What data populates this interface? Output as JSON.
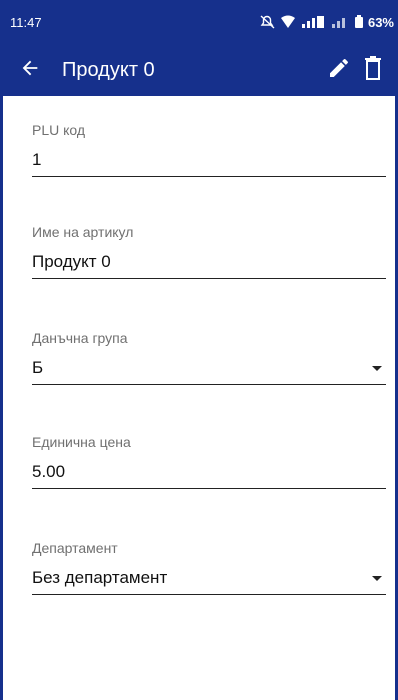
{
  "status_bar": {
    "time": "11:47",
    "battery": "63%",
    "icons": [
      "mute-icon",
      "wifi-icon",
      "signal-icon",
      "signal-icon",
      "battery-icon"
    ]
  },
  "app_bar": {
    "title": "Продукт 0",
    "back_icon": "arrow-left-icon",
    "edit_icon": "pencil-icon",
    "delete_icon": "trash-icon",
    "color": "#16308c"
  },
  "form": {
    "plu": {
      "label": "PLU код",
      "value": "1"
    },
    "name": {
      "label": "Име на артикул",
      "value": "Продукт 0"
    },
    "tax_group": {
      "label": "Данъчна група",
      "value": "Б"
    },
    "unit_price": {
      "label": "Единична цена",
      "value": "5.00"
    },
    "department": {
      "label": "Департамент",
      "value": "Без департамент"
    }
  }
}
